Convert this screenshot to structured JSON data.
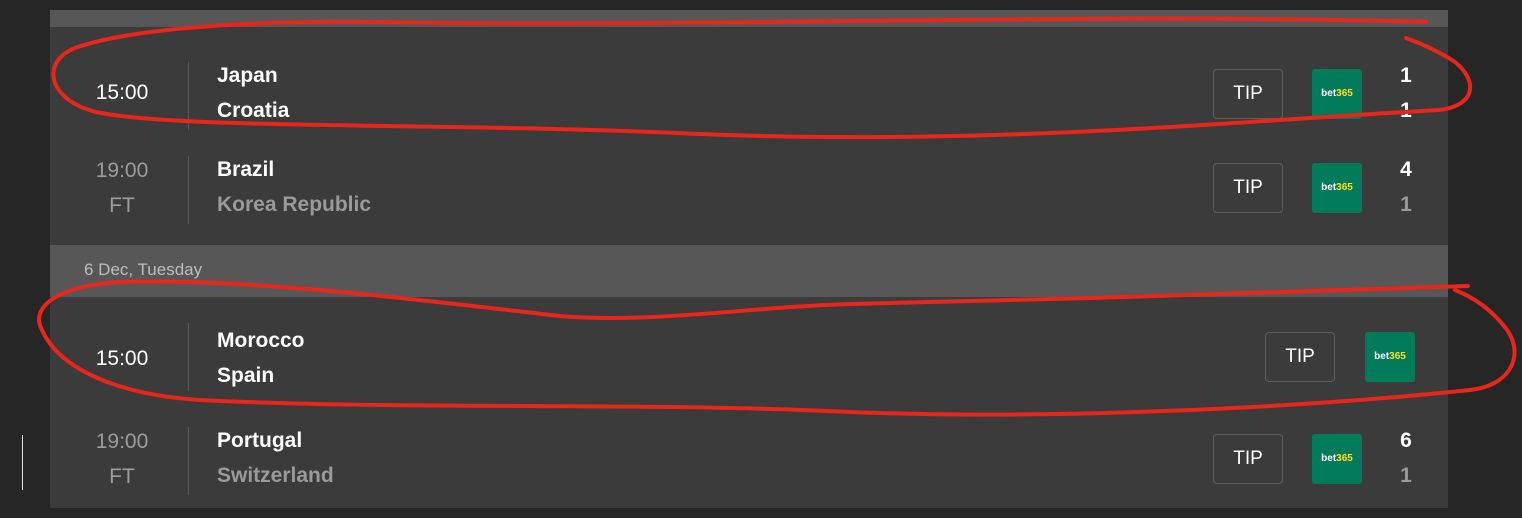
{
  "dates": [
    {
      "label": "6 Dec, Tuesday"
    }
  ],
  "matches": [
    {
      "time": "15:00",
      "status": "",
      "home": "Japan",
      "away": "Croatia",
      "home_score": "1",
      "away_score": "1",
      "tip_label": "TIP",
      "odds_brand": "bet365"
    },
    {
      "time": "19:00",
      "status": "FT",
      "home": "Brazil",
      "away": "Korea Republic",
      "home_score": "4",
      "away_score": "1",
      "tip_label": "TIP",
      "odds_brand": "bet365"
    },
    {
      "time": "15:00",
      "status": "",
      "home": "Morocco",
      "away": "Spain",
      "home_score": "",
      "away_score": "",
      "tip_label": "TIP",
      "odds_brand": "bet365"
    },
    {
      "time": "19:00",
      "status": "FT",
      "home": "Portugal",
      "away": "Switzerland",
      "home_score": "6",
      "away_score": "1",
      "tip_label": "TIP",
      "odds_brand": "bet365"
    }
  ],
  "colors": {
    "page_bg": "#262626",
    "panel_bg": "#3b3b3b",
    "date_header_bg": "#575757",
    "bet365_green": "#027b5b",
    "bet365_yellow": "#ffdf1b",
    "annotation_red": "#e8261c"
  },
  "annotations": [
    "red-circle-japan-croatia",
    "red-circle-morocco-spain"
  ]
}
